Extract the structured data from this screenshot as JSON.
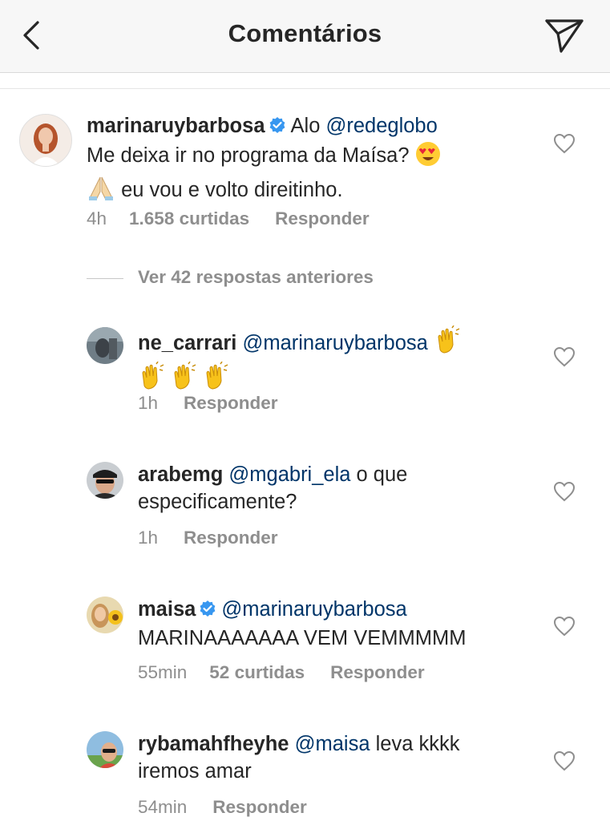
{
  "header": {
    "title": "Comentários",
    "back_icon": "chevron-left-icon",
    "send_icon": "paper-plane-icon"
  },
  "main_comment": {
    "username": "marinaruybarbosa",
    "verified": true,
    "text_parts": [
      "Alo ",
      "@redeglobo",
      "Me deixa ir no programa da Maísa? ",
      "eu vou e volto direitinho."
    ],
    "emojis": [
      "heart-eyes-emoji",
      "praying-hands-emoji"
    ],
    "time": "4h",
    "likes": "1.658 curtidas",
    "reply": "Responder"
  },
  "view_replies": "Ver 42 respostas anteriores",
  "replies": [
    {
      "username": "ne_carrari",
      "mention": "@marinaruybarbosa",
      "emojis": [
        "clapping-hands-emoji",
        "clapping-hands-emoji",
        "clapping-hands-emoji",
        "clapping-hands-emoji"
      ],
      "time": "1h",
      "reply": "Responder"
    },
    {
      "username": "arabemg",
      "mention": "@mgabri_ela",
      "text1": " o que",
      "text2": "especificamente?",
      "time": "1h",
      "reply": "Responder"
    },
    {
      "username": "maisa",
      "verified": true,
      "mention": "@marinaruybarbosa",
      "text2": "MARINAAAAAAA VEM VEMMMMM",
      "time": "55min",
      "likes": "52 curtidas",
      "reply": "Responder"
    },
    {
      "username": "rybamahfheyhe",
      "mention": "@maisa",
      "text1": " leva kkkk",
      "text2": "iremos amar",
      "time": "54min",
      "reply": "Responder"
    }
  ],
  "colors": {
    "mention": "#003569",
    "meta": "#8e8e8e",
    "verified": "#3897f0",
    "header_bg": "#f7f7f7"
  }
}
